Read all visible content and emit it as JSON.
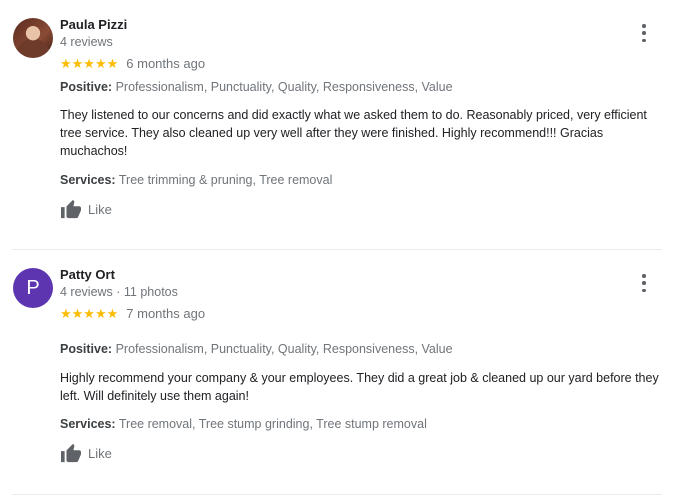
{
  "reviews": [
    {
      "author": "Paula Pizzi",
      "meta": "4 reviews",
      "stars": "★★★★★",
      "rating": 5,
      "date": "6 months ago",
      "positive_label": "Positive:",
      "positive_value": "Professionalism, Punctuality, Quality, Responsiveness, Value",
      "text": "They listened to our concerns and did exactly what we asked them to do. Reasonably priced, very efficient tree service. They also cleaned up very well after they were finished. Highly recommend!!! Gracias muchachos!",
      "services_label": "Services:",
      "services_value": "Tree trimming & pruning, Tree removal",
      "like_label": "Like"
    },
    {
      "author": "Patty Ort",
      "avatar_letter": "P",
      "avatar_color": "#5e35b1",
      "meta": "4 reviews · 11 photos",
      "stars": "★★★★★",
      "rating": 5,
      "date": "7 months ago",
      "positive_label": "Positive:",
      "positive_value": "Professionalism, Punctuality, Quality, Responsiveness, Value",
      "text": "Highly recommend your company & your employees. They did a great job & cleaned up our yard before they left. Will definitely use them again!",
      "services_label": "Services:",
      "services_value": "Tree removal, Tree stump grinding, Tree stump removal",
      "like_label": "Like"
    }
  ],
  "colors": {
    "star": "#fbbc04",
    "secondary_text": "#70757a",
    "divider": "#ebebeb"
  }
}
